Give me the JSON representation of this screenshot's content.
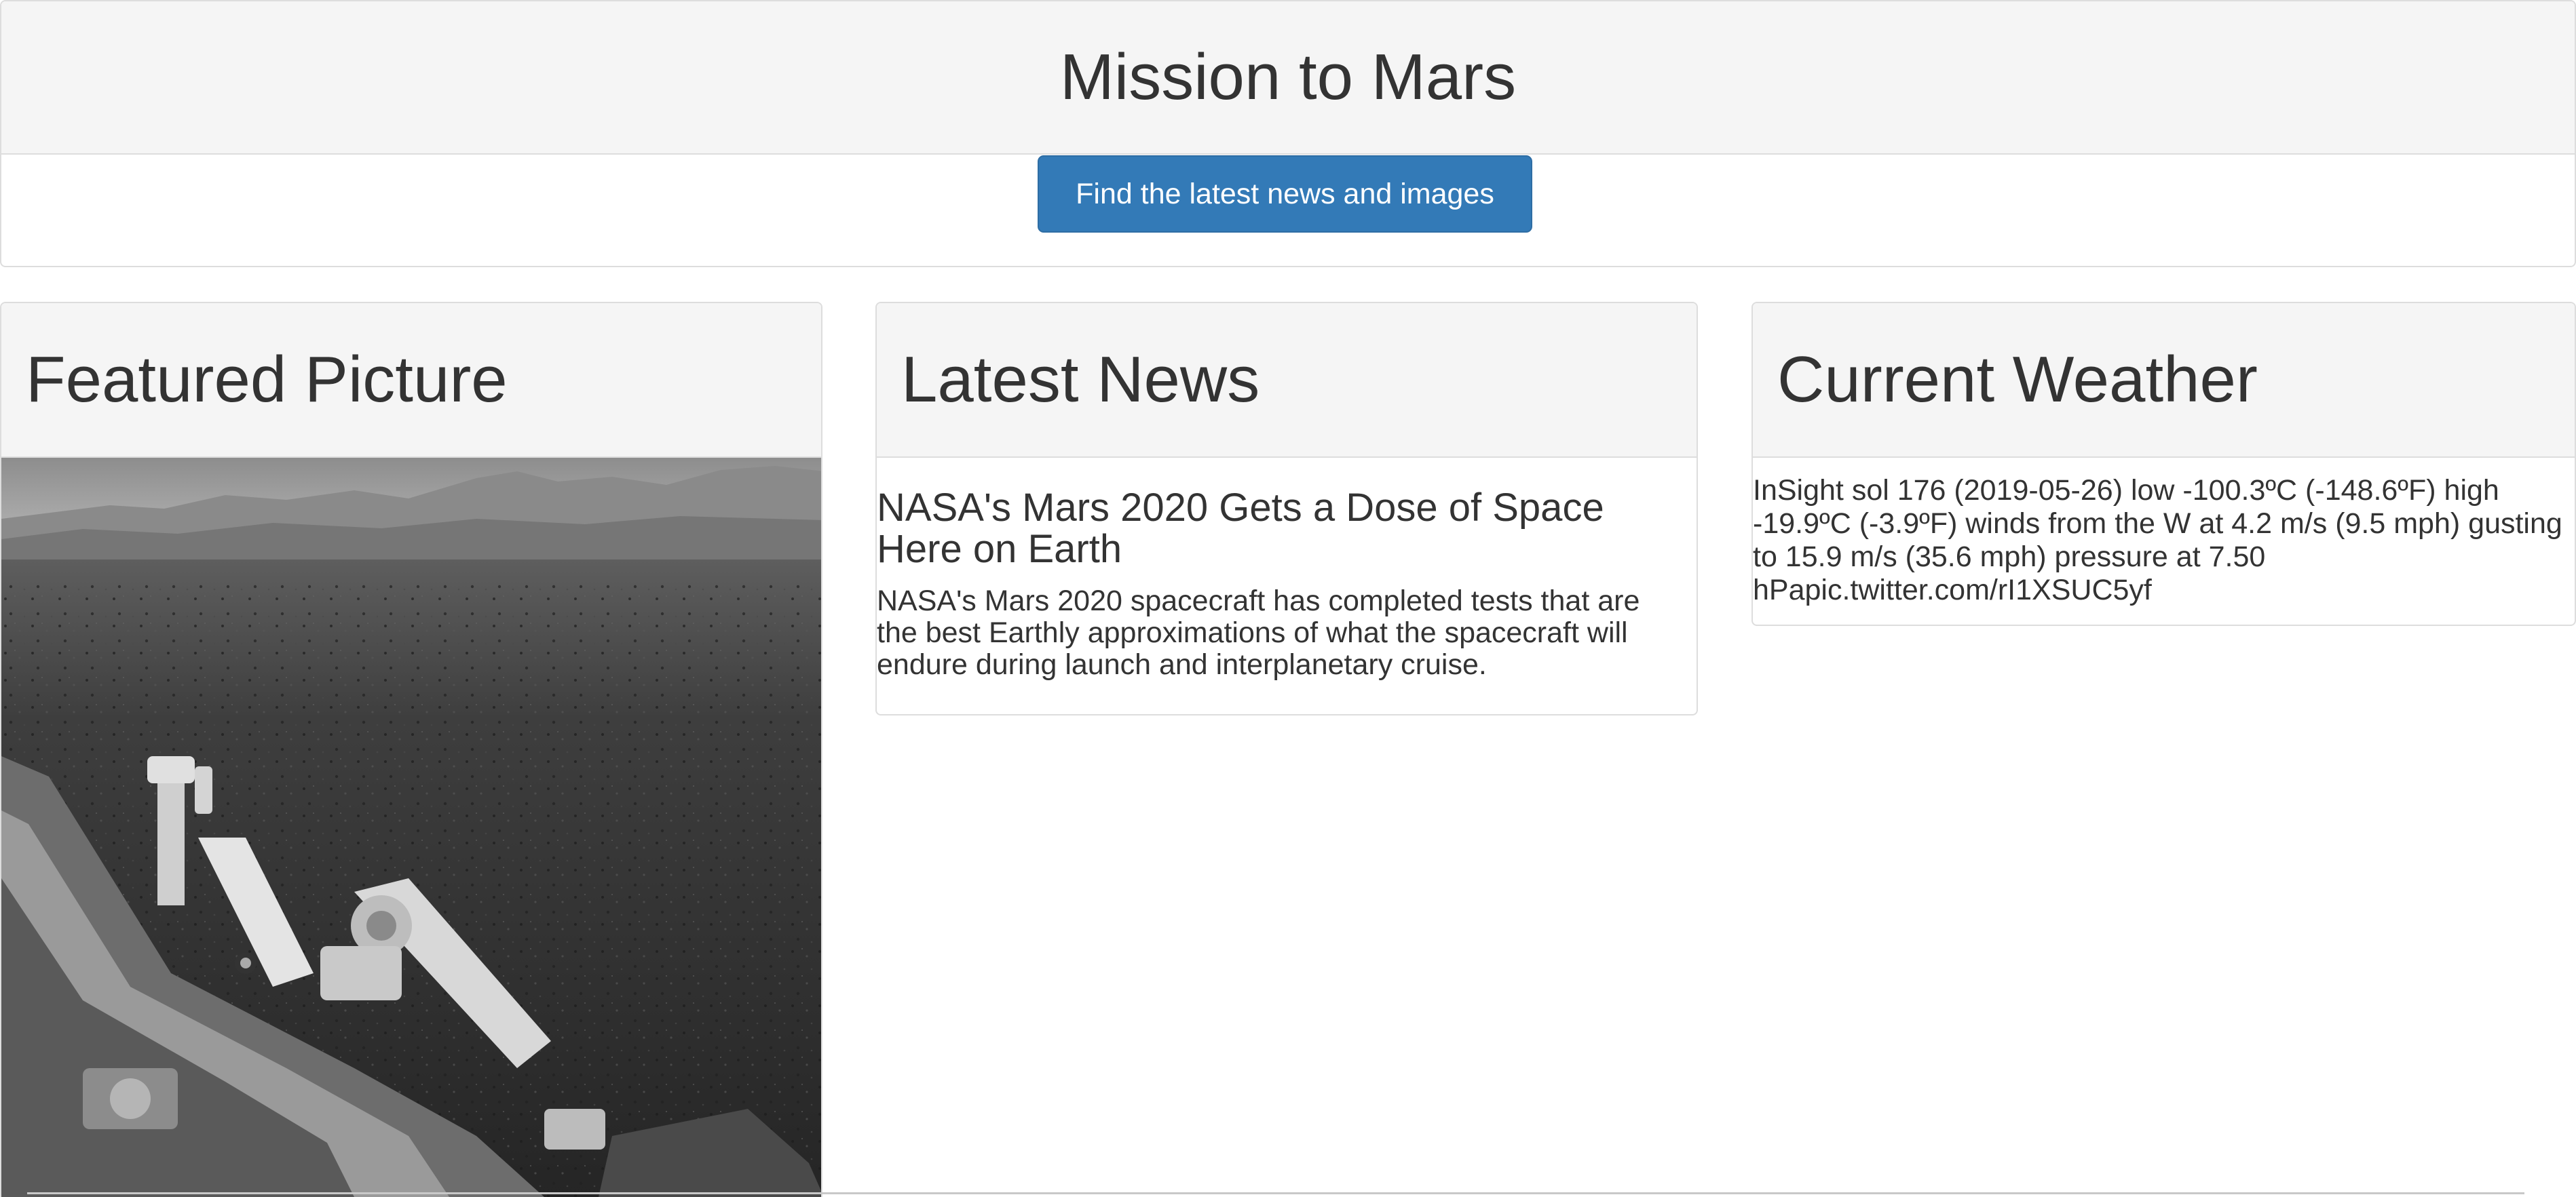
{
  "header": {
    "title": "Mission to Mars",
    "button_label": "Find the latest news and images"
  },
  "featured": {
    "title": "Featured Picture",
    "image_alt": "Mars rover camera view of rocky plain and distant hills"
  },
  "news": {
    "section_title": "Latest News",
    "headline": "NASA's Mars 2020 Gets a Dose of Space Here on Earth",
    "paragraph": "NASA's Mars 2020 spacecraft has completed tests that are the best Earthly approximations of what the spacecraft will endure during launch and interplanetary cruise."
  },
  "weather": {
    "section_title": "Current Weather",
    "report": "InSight sol 176 (2019-05-26) low -100.3ºC (-148.6ºF) high -19.9ºC (-3.9ºF) winds from the W at 4.2 m/s (9.5 mph) gusting to 15.9 m/s (35.6 mph) pressure at 7.50 hPapic.twitter.com/rI1XSUC5yf"
  },
  "colors": {
    "button_bg": "#337ab7",
    "panel_heading_bg": "#f5f5f5",
    "border": "#dddddd",
    "text": "#333333"
  }
}
